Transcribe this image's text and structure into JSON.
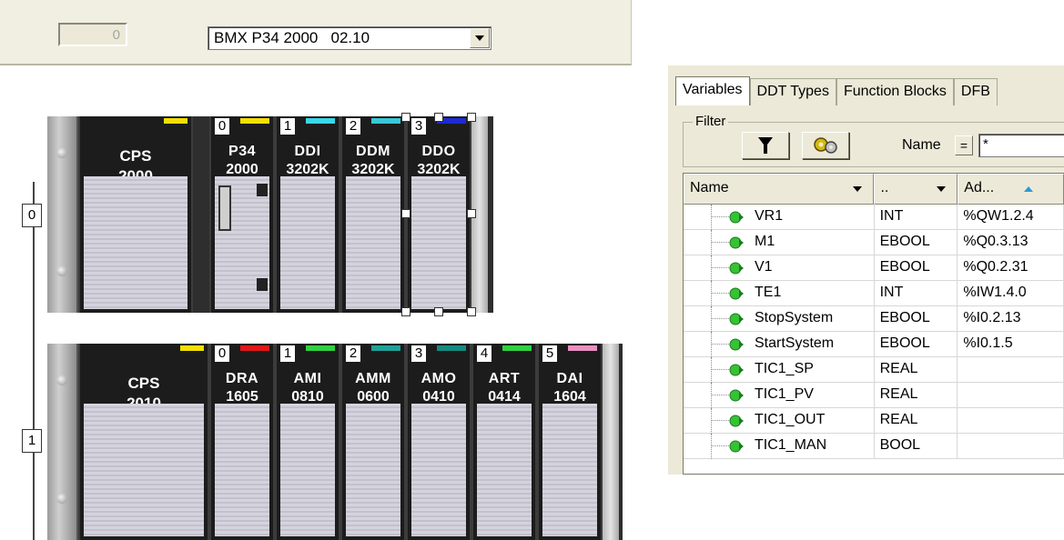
{
  "toolbar": {
    "rack_number_value": "0",
    "cpu_selection": "BMX P34 2000   02.10"
  },
  "racks": [
    {
      "index_label": "0",
      "power_supply": {
        "line1": "CPS",
        "line2": "2000",
        "stripe": "#f1e000"
      },
      "modules": [
        {
          "slot": "0",
          "name": "P34",
          "ref": "2000",
          "stripe": "#f1e000"
        },
        {
          "slot": "1",
          "name": "DDI",
          "ref": "3202K",
          "stripe": "#38d8e8"
        },
        {
          "slot": "2",
          "name": "DDM",
          "ref": "3202K",
          "stripe": "#38c8d8"
        },
        {
          "slot": "3",
          "name": "DDO",
          "ref": "3202K",
          "stripe": "#1c2ad8"
        }
      ]
    },
    {
      "index_label": "1",
      "power_supply": {
        "line1": "CPS",
        "line2": "2010",
        "stripe": "#f1e000"
      },
      "modules": [
        {
          "slot": "0",
          "name": "DRA",
          "ref": "1605",
          "stripe": "#e01818"
        },
        {
          "slot": "1",
          "name": "AMI",
          "ref": "0810",
          "stripe": "#30d040"
        },
        {
          "slot": "2",
          "name": "AMM",
          "ref": "0600",
          "stripe": "#20a098"
        },
        {
          "slot": "3",
          "name": "AMO",
          "ref": "0410",
          "stripe": "#158a80"
        },
        {
          "slot": "4",
          "name": "ART",
          "ref": "0414",
          "stripe": "#30d040"
        },
        {
          "slot": "5",
          "name": "DAI",
          "ref": "1604",
          "stripe": "#e890c0"
        }
      ]
    }
  ],
  "variables_panel": {
    "tabs": [
      "Variables",
      "DDT Types",
      "Function Blocks",
      "DFB"
    ],
    "active_tab": "Variables",
    "filter_label": "Filter",
    "name_filter_label": "Name",
    "eq_label": "=",
    "name_filter_value": "*",
    "columns": {
      "name": "Name",
      "type": "..",
      "address": "Ad..."
    },
    "rows": [
      {
        "name": "VR1",
        "type": "INT",
        "address": "%QW1.2.4"
      },
      {
        "name": "M1",
        "type": "EBOOL",
        "address": "%Q0.3.13"
      },
      {
        "name": "V1",
        "type": "EBOOL",
        "address": "%Q0.2.31"
      },
      {
        "name": "TE1",
        "type": "INT",
        "address": "%IW1.4.0"
      },
      {
        "name": "StopSystem",
        "type": "EBOOL",
        "address": "%I0.2.13"
      },
      {
        "name": "StartSystem",
        "type": "EBOOL",
        "address": "%I0.1.5"
      },
      {
        "name": "TIC1_SP",
        "type": "REAL",
        "address": ""
      },
      {
        "name": "TIC1_PV",
        "type": "REAL",
        "address": ""
      },
      {
        "name": "TIC1_OUT",
        "type": "REAL",
        "address": ""
      },
      {
        "name": "TIC1_MAN",
        "type": "BOOL",
        "address": ""
      }
    ]
  },
  "colors": {
    "variable_icon": "#35c235",
    "module_face": "#1c1c1c"
  }
}
